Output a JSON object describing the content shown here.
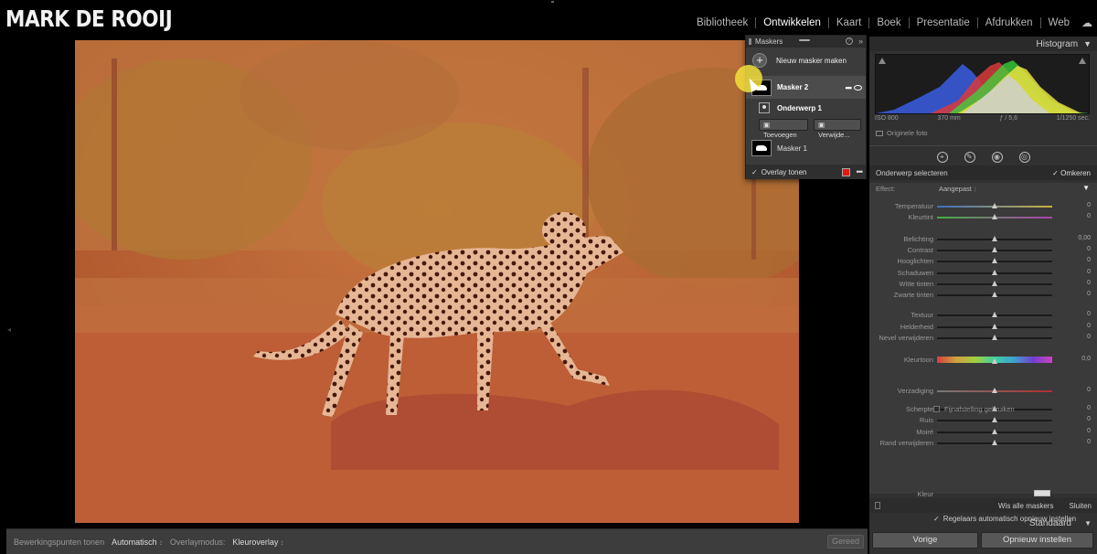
{
  "brand": "MARK DE ROOIJ",
  "nav": {
    "modules": [
      {
        "label": "Bibliotheek",
        "active": false
      },
      {
        "label": "Ontwikkelen",
        "active": true
      },
      {
        "label": "Kaart",
        "active": false
      },
      {
        "label": "Boek",
        "active": false
      },
      {
        "label": "Presentatie",
        "active": false
      },
      {
        "label": "Afdrukken",
        "active": false
      },
      {
        "label": "Web",
        "active": false
      }
    ],
    "cloud_icon": "cloud-icon"
  },
  "masks_panel": {
    "title": "Maskers",
    "new_mask": "Nieuw masker maken",
    "mask2": "Masker 2",
    "component": "Onderwerp 1",
    "add": "Toevoegen",
    "remove": "Verwijde...",
    "mask1": "Masker 1",
    "overlay": "Overlay tonen",
    "overlay_color": "#e01a0f"
  },
  "histogram": {
    "title": "Histogram",
    "iso": "ISO 800",
    "focal": "370 mm",
    "aperture": "ƒ / 5,6",
    "shutter": "1/1250 sec.",
    "original": "Originele foto"
  },
  "selection": {
    "label": "Onderwerp selecteren",
    "invert": "Omkeren"
  },
  "effect": {
    "label": "Effect:",
    "value": "Aangepast"
  },
  "sliders": [
    {
      "label": "Temperatuur",
      "value": "0",
      "pos": 0.5,
      "grad": "linear-gradient(90deg,#3f6fc0,#c8b040)"
    },
    {
      "label": "Kleurtint",
      "value": "0",
      "pos": 0.5,
      "grad": "linear-gradient(90deg,#40b040,#b040b0)"
    },
    {
      "label": "Belichting",
      "value": "0,00",
      "pos": 0.5
    },
    {
      "label": "Contrast",
      "value": "0",
      "pos": 0.5
    },
    {
      "label": "Hooglichten",
      "value": "0",
      "pos": 0.5
    },
    {
      "label": "Schaduwen",
      "value": "0",
      "pos": 0.5
    },
    {
      "label": "Witte tinten",
      "value": "0",
      "pos": 0.5
    },
    {
      "label": "Zwarte tinten",
      "value": "0",
      "pos": 0.5
    },
    {
      "label": "Textuur",
      "value": "0",
      "pos": 0.5
    },
    {
      "label": "Helderheid",
      "value": "0",
      "pos": 0.5
    },
    {
      "label": "Nevel verwijderen",
      "value": "0",
      "pos": 0.5
    },
    {
      "label": "Kleurtoon",
      "value": "0,0",
      "pos": 0.5,
      "hue": true
    },
    {
      "label": "Verzadiging",
      "value": "0",
      "pos": 0.5,
      "grad": "linear-gradient(90deg,#777,#b03030)"
    },
    {
      "label": "Scherpte",
      "value": "0",
      "pos": 0.5
    },
    {
      "label": "Ruis",
      "value": "0",
      "pos": 0.5
    },
    {
      "label": "Moiré",
      "value": "0",
      "pos": 0.5
    },
    {
      "label": "Rand verwijderen",
      "value": "0",
      "pos": 0.5
    }
  ],
  "fine_adjust": "Fijnafstelling gebruiken",
  "color_label": "Kleur",
  "auto_reset": "Regelaars automatisch opnieuw instellen",
  "footer": {
    "clear_all": "Wis alle maskers",
    "close": "Sluiten"
  },
  "preset": "Standaard",
  "buttons": {
    "previous": "Vorige",
    "reset": "Opnieuw instellen"
  },
  "bottom_toolbar": {
    "edit_points_label": "Bewerkingspunten tonen",
    "edit_points_value": "Automatisch",
    "overlay_mode_label": "Overlaymodus:",
    "overlay_mode_value": "Kleuroverlay",
    "done": "Gereed"
  }
}
